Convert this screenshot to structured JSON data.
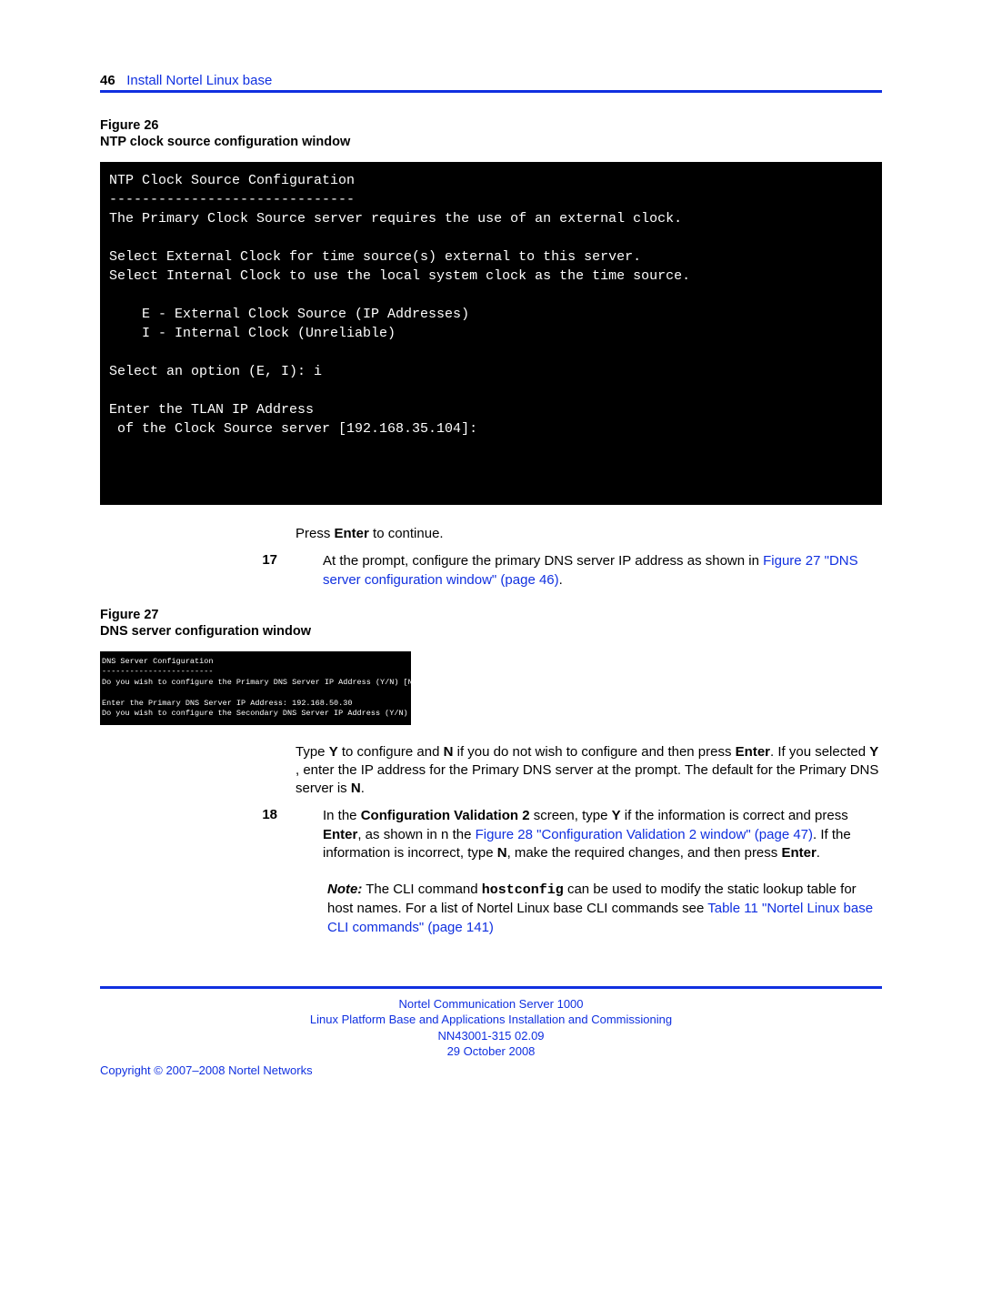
{
  "page_number": "46",
  "section_title": "Install Nortel Linux base",
  "figure26": {
    "label": "Figure 26",
    "title": "NTP clock source configuration window",
    "terminal": "NTP Clock Source Configuration\n------------------------------\nThe Primary Clock Source server requires the use of an external clock.\n\nSelect External Clock for time source(s) external to this server.\nSelect Internal Clock to use the local system clock as the time source.\n\n    E - External Clock Source (IP Addresses)\n    I - Internal Clock (Unreliable)\n\nSelect an option (E, I): i\n\nEnter the TLAN IP Address\n of the Clock Source server [192.168.35.104]:\n\n\n\n"
  },
  "press_enter_1": " to continue.",
  "step17": {
    "num": "17",
    "text_a": "At the prompt, configure the primary DNS server IP address as shown in ",
    "link": "Figure 27 \"DNS server configuration window\" (page 46)",
    "text_b": "."
  },
  "figure27": {
    "label": "Figure 27",
    "title": "DNS server configuration window",
    "terminal": "DNS Server Configuration\n------------------------\nDo you wish to configure the Primary DNS Server IP Address (Y/N) [N]? y\n\nEnter the Primary DNS Server IP Address: 192.168.50.30\nDo you wish to configure the Secondary DNS Server IP Address (Y/N) [N]?"
  },
  "para_yn": {
    "a": "Type ",
    "y": "Y",
    "b": " to configure and ",
    "n": "N",
    "c": " if you do not wish to configure and then press ",
    "enter": "Enter",
    "d": ".  If you selected ",
    "y2": "Y",
    "e": " , enter the IP address for the Primary DNS server at the prompt.  The default for the Primary DNS server is ",
    "n2": "N",
    "f": "."
  },
  "step18": {
    "num": "18",
    "a": "In the ",
    "cv2": "Configuration Validation 2",
    "b": " screen, type ",
    "y": "Y",
    "c": " if the information is correct and press ",
    "enter": "Enter",
    "d": ", as shown in n the ",
    "link": "Figure 28 \"Configuration Validation 2 window\" (page 47)",
    "e": ".  If the information is incorrect, type ",
    "n": "N",
    "f": ", make the required changes, and then press ",
    "enter2": "Enter",
    "g": "."
  },
  "note": {
    "label": "Note:",
    "a": "  The CLI command ",
    "cmd": "hostconfig",
    "b": " can be used to modify the static lookup table for host names.  For a list of Nortel Linux base CLI commands see ",
    "link": "Table 11 \"Nortel Linux base CLI commands\" (page 141)"
  },
  "footer": {
    "l1": "Nortel Communication Server 1000",
    "l2": "Linux Platform Base and Applications Installation and Commissioning",
    "l3": "NN43001-315   02.09",
    "l4": "29 October 2008",
    "copyright": "Copyright © 2007–2008 Nortel Networks"
  }
}
